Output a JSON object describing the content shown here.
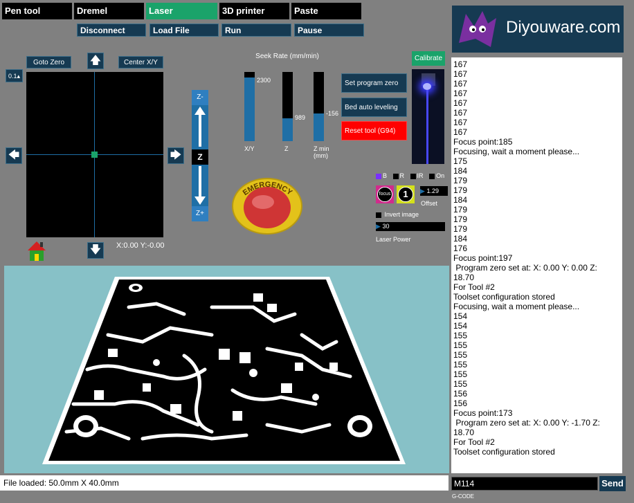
{
  "tabs": [
    {
      "label": "Pen tool",
      "active": false
    },
    {
      "label": "Dremel",
      "active": false
    },
    {
      "label": "Laser",
      "active": true
    },
    {
      "label": "3D printer",
      "active": false
    },
    {
      "label": "Paste Dispenser",
      "active": false
    }
  ],
  "actions": {
    "disconnect": "Disconnect",
    "load_file": "Load File",
    "run": "Run",
    "pause": "Pause"
  },
  "brand": {
    "name": "Diyouware.com"
  },
  "jog": {
    "step": "0.1",
    "goto_zero": "Goto Zero",
    "center_xy": "Center X/Y",
    "position": "X:0.00 Y:-0.00",
    "z_up": "Z-",
    "z_label": "Z",
    "z_down": "Z+"
  },
  "seek": {
    "title": "Seek Rate (mm/min)",
    "gauges": [
      {
        "label": "X/Y",
        "value": "2300",
        "fill": 0.92
      },
      {
        "label": "Z",
        "value": "989",
        "fill": 0.33
      },
      {
        "label": "Z min (mm)",
        "value": "-156",
        "fill": 0.4
      }
    ]
  },
  "emergency": {
    "label": "EMERGENCY"
  },
  "side_actions": {
    "set_program_zero": "Set program zero",
    "bed_auto_leveling": "Bed auto leveling",
    "reset_tool": "Reset tool (G94)",
    "calibrate": "Calibrate"
  },
  "laser": {
    "colors": [
      "B",
      "R",
      "IR",
      "On"
    ],
    "focus_label": "focus",
    "count": "1",
    "offset_value": "1.29",
    "offset_label": "Offset",
    "invert_image": "Invert image",
    "power_value": "30",
    "power_label": "Laser Power"
  },
  "log": [
    "167",
    "167",
    "167",
    "167",
    "167",
    "167",
    "167",
    "167",
    "Focus point:185",
    "Focusing, wait a moment please...",
    "175",
    "184",
    "179",
    "179",
    "184",
    "179",
    "179",
    "179",
    "184",
    "176",
    "Focus point:197",
    " Program zero set at: X: 0.00 Y: 0.00 Z:",
    "18.70",
    "For Tool #2",
    "Toolset configuration stored",
    "Focusing, wait a moment please...",
    "154",
    "154",
    "155",
    "155",
    "155",
    "155",
    "155",
    "155",
    "156",
    "156",
    "Focus point:173",
    " Program zero set at: X: 0.00 Y: -1.70 Z:",
    "18.70",
    "For Tool #2",
    "Toolset configuration stored"
  ],
  "status": {
    "file_loaded": "File loaded: 50.0mm X 40.0mm"
  },
  "command": {
    "value": "M114",
    "send": "Send",
    "label": "G-CODE"
  },
  "colors": {
    "accent": "#1aa36a",
    "button": "#163a52",
    "danger": "#ff0000",
    "preview_bg": "#87c1c7"
  }
}
